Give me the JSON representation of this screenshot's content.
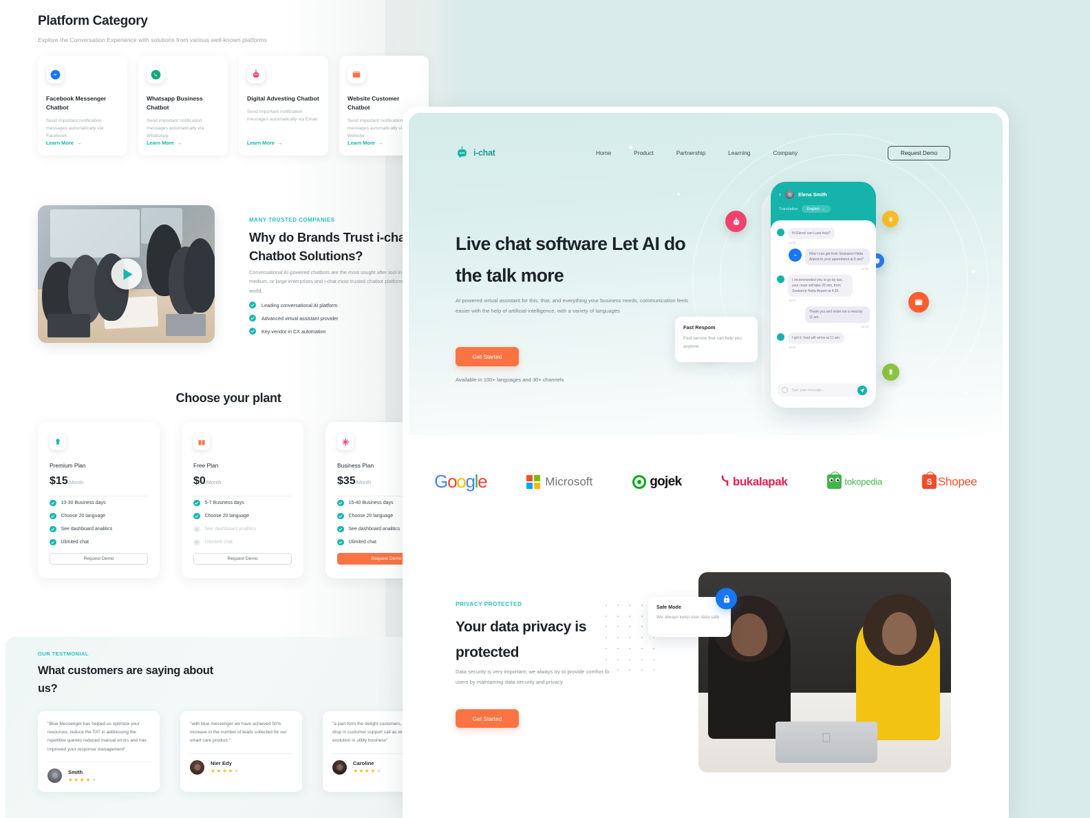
{
  "left": {
    "section_title": "Platform Category",
    "section_sub": "Explore the Conversation Experience with solutions from various well-known platforms",
    "platforms": [
      {
        "icon": "facebook-messenger-icon",
        "name": "Facebook Messenger Chatbot",
        "desc": "Send important notification messages automatically via Facebook",
        "link": "Learn More"
      },
      {
        "icon": "whatsapp-icon",
        "name": "Whatsapp Business Chatbot",
        "desc": "Send important notification messages automatically via WhatsApp",
        "link": "Learn More"
      },
      {
        "icon": "robot-icon",
        "name": "Digital Advesting Chatbot",
        "desc": "Send important notification messages automatically via Email",
        "link": "Learn More"
      },
      {
        "icon": "window-icon",
        "name": "Website Customer Chatbot",
        "desc": "Send important notification messages automatically via Website",
        "link": "Learn More"
      }
    ],
    "trust": {
      "eyebrow": "MANY TRUSTED COMPANIES",
      "title": "Why do Brands Trust i-chat for Chatbot Solutions?",
      "body": "Conversational AI-powered chatbots are the most sought after tool in the current times by small, medium, or large enterprises and i-chat most trusted chatbot platform global brands around the world.",
      "bullets": [
        "Leading conversational AI platform",
        "Advanced virtual assistant provider",
        "Key vendor in CX automation"
      ]
    },
    "pricing": {
      "title": "Choose your plant",
      "plans": [
        {
          "icon": "badge-icon",
          "name": "Premium Plan",
          "price": "$15",
          "period": "/Month",
          "features": [
            {
              "label": "10-30 Business days",
              "enabled": true
            },
            {
              "label": "Choose 20 language",
              "enabled": true
            },
            {
              "label": "See dashboard analitics",
              "enabled": true
            },
            {
              "label": "Ulimited chat",
              "enabled": true
            }
          ],
          "cta": "Request Demo",
          "primary": false
        },
        {
          "icon": "gift-icon",
          "name": "Free Plan",
          "price": "$0",
          "period": "/Month",
          "features": [
            {
              "label": "5-7 Business days",
              "enabled": true
            },
            {
              "label": "Choose 20 language",
              "enabled": true
            },
            {
              "label": "See dashboard analitics",
              "enabled": false
            },
            {
              "label": "Ulimited chat",
              "enabled": false
            }
          ],
          "cta": "Request Demo",
          "primary": false
        },
        {
          "icon": "sparkle-icon",
          "name": "Business Plan",
          "price": "$35",
          "period": "/Month",
          "features": [
            {
              "label": "15-40 Business days",
              "enabled": true
            },
            {
              "label": "Choose 20 language",
              "enabled": true
            },
            {
              "label": "See dashboard analitics",
              "enabled": true
            },
            {
              "label": "Ulimited chat",
              "enabled": true
            }
          ],
          "cta": "Request Demo",
          "primary": true
        }
      ]
    },
    "testimonial": {
      "eyebrow": "OUR TESTMONIAL",
      "title": "What customers are saying about us?",
      "cards": [
        {
          "quote": "\"Blue Messenger has helped us optimize your resources, reduce the TAT in addressing the repetitive queries reduced manual errors and has improved your response management\"",
          "name": "Smith",
          "rating": 4,
          "max": 5
        },
        {
          "quote": "\"with blue messenger we have achieved 50% increase in the number of leads collected for our smart care product \"",
          "name": "Nier Edy",
          "rating": 4,
          "max": 5
        },
        {
          "quote": "\"a part form the delight customers, we've seen a drop in customer support call as wich is major evolution in utility business\"",
          "name": "Caroline",
          "rating": 4,
          "max": 5
        }
      ]
    }
  },
  "site": {
    "brand": "i-chat",
    "nav": [
      "Home",
      "Product",
      "Partnership",
      "Learning",
      "Company"
    ],
    "nav_cta": "Request Demo",
    "hero": {
      "headline": "Live chat software Let AI do the talk more",
      "body": "AI powered virtual assistant for this, that, and everything your business needs, communication feels easier with the help of artificial intelligence, with a variety of languages",
      "cta": "Get Started",
      "note": "Available in 100+ languages and 30+ channels"
    },
    "phone": {
      "contact": "Elena Smith",
      "translation_label": "Translation",
      "language": "English",
      "messages": [
        {
          "from": "bot",
          "text": "Hi Elena! can Luna help?",
          "time": "11:30"
        },
        {
          "from": "user",
          "text": "How I can get from Soekarno Hatta Airport to your aparetment at 6 am?",
          "time": "14:40"
        },
        {
          "from": "bot",
          "text": "I recommended you to go by taxi. your route will take 25 min, from Soekarno Hatta Airport at 4:20.",
          "time": "15:41"
        },
        {
          "from": "user",
          "text": "Thank you and order me a meal by 11 am.",
          "time": "15:42"
        },
        {
          "from": "bot",
          "text": "I got it. food will arrive at 11 am.",
          "time": "15:43"
        }
      ],
      "input_placeholder": "Type your message.."
    },
    "fast_card": {
      "title": "Fast Respom",
      "body": "Fast service that can help you anytime"
    },
    "float_icons": [
      "robot-icon",
      "bell-icon",
      "shield-icon",
      "whatsapp-icon",
      "window-icon",
      "badge-icon"
    ],
    "logos": [
      "Google",
      "Microsoft",
      "gojek",
      "bukalapak",
      "tokopedia",
      "Shopee"
    ],
    "privacy": {
      "eyebrow": "PRIVACY PROTECTED",
      "title": "Your data privacy is protected",
      "body": "Data security is very important, we always try to provide comfort to users by maintaining data security and privacy",
      "cta": "Get Started",
      "safe_card": {
        "title": "Safe Mode",
        "body": "We always keep user data safe",
        "icon": "lock-icon"
      }
    }
  },
  "colors": {
    "teal": "#17b6ae",
    "orange": "#fa7343",
    "bg_teal": "#d9ecea",
    "heading": "#1d2228"
  }
}
